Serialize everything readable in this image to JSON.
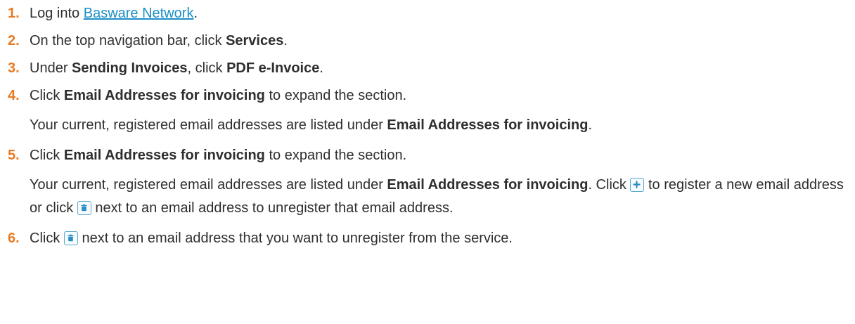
{
  "steps": [
    {
      "num": "1.",
      "pre": "Log into ",
      "link": "Basware Network",
      "post": "."
    },
    {
      "num": "2.",
      "pre": "On the top navigation bar, click ",
      "b1": "Services",
      "post": "."
    },
    {
      "num": "3.",
      "pre": "Under ",
      "b1": "Sending Invoices",
      "mid": ", click ",
      "b2": "PDF e-Invoice",
      "post": "."
    },
    {
      "num": "4.",
      "pre": "Click ",
      "b1": "Email Addresses for invoicing",
      "post": " to expand the section.",
      "sub_pre": "Your current, registered email addresses are listed under ",
      "sub_b": "Email Addresses for invoicing",
      "sub_post": "."
    },
    {
      "num": "5.",
      "pre": "Click ",
      "b1": "Email Addresses for invoicing",
      "post": " to expand the section.",
      "sub_pre": "Your current, registered email addresses are listed under ",
      "sub_b": "Email Addresses for invoicing",
      "sub_mid": ". Click ",
      "sub_mid2": " to register a new email address or click ",
      "sub_post": " next to an email address to unregister that email address."
    },
    {
      "num": "6.",
      "pre": "Click ",
      "post": " next to an email address that you want to unregister from the service."
    }
  ],
  "icons": {
    "add": "plus-icon",
    "delete": "trash-icon"
  },
  "colors": {
    "number": "#e87b24",
    "link": "#1c8fc6",
    "icon_border": "#5aa8cf",
    "text": "#2e2e2e"
  }
}
